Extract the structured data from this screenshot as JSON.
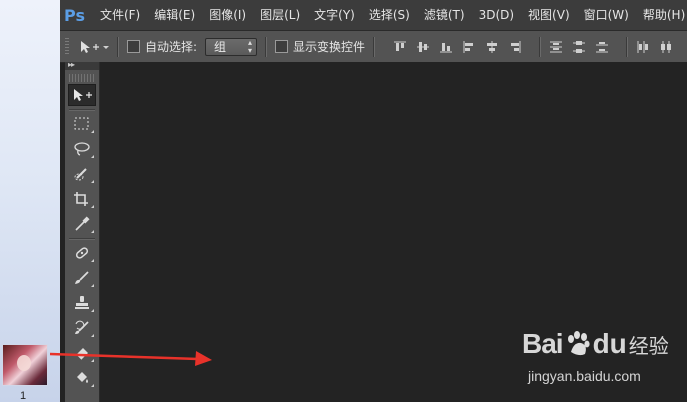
{
  "desktop": {
    "icon_label": "1"
  },
  "app": {
    "logo": "Ps",
    "menu": [
      "文件(F)",
      "编辑(E)",
      "图像(I)",
      "图层(L)",
      "文字(Y)",
      "选择(S)",
      "滤镜(T)",
      "3D(D)",
      "视图(V)",
      "窗口(W)",
      "帮助(H)"
    ]
  },
  "options_bar": {
    "auto_select_label": "自动选择:",
    "auto_select_value": "组",
    "show_transform_label": "显示变换控件"
  },
  "toolbox": {
    "collapse_glyph": "▸▸",
    "tools": [
      "move-icon",
      "marquee-icon",
      "lasso-icon",
      "quick-selection-icon",
      "crop-icon",
      "eyedropper-icon",
      "healing-brush-icon",
      "brush-icon",
      "clone-stamp-icon",
      "history-brush-icon",
      "eraser-icon",
      "paint-bucket-icon"
    ]
  },
  "watermark": {
    "brand_bai": "Bai",
    "brand_du": "du",
    "brand_jingyan": "经验",
    "url": "jingyan.baidu.com"
  },
  "colors": {
    "menubar": "#3c3c3c",
    "panel": "#535353",
    "canvas": "#232323",
    "ps_blue": "#5b9ee6",
    "arrow_red": "#e8322a"
  }
}
